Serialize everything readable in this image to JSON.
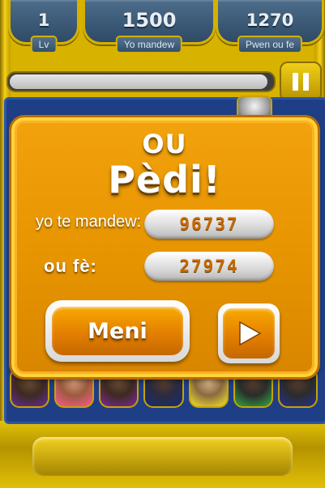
{
  "hud": {
    "level_value": "1",
    "level_label": "Lv",
    "target_value": "1500",
    "target_label": "Yo mandew",
    "score_value": "1270",
    "score_label": "Pwen ou fe"
  },
  "progress": {
    "fraction": 0.98
  },
  "dialog": {
    "title_line1": "OU",
    "title_line2": "Pèdi!",
    "target_row_label": "yo te mandew:",
    "target_row_value": "96737",
    "score_row_label": "ou fè:",
    "score_row_value": "27974",
    "menu_button_label": "Meni",
    "play_button_icon": "play-icon"
  },
  "colors": {
    "dialog_orange": "#e69400",
    "dialog_border": "#ffd23a",
    "hud_blue": "#2e4a66",
    "board_blue": "#1e3f86",
    "gold": "#d4b100"
  },
  "pause_button_icon": "pause-icon",
  "board_pieces": [
    "portrait-piece",
    "portrait-piece",
    "portrait-piece",
    "portrait-piece",
    "portrait-piece",
    "portrait-piece",
    "portrait-piece"
  ]
}
